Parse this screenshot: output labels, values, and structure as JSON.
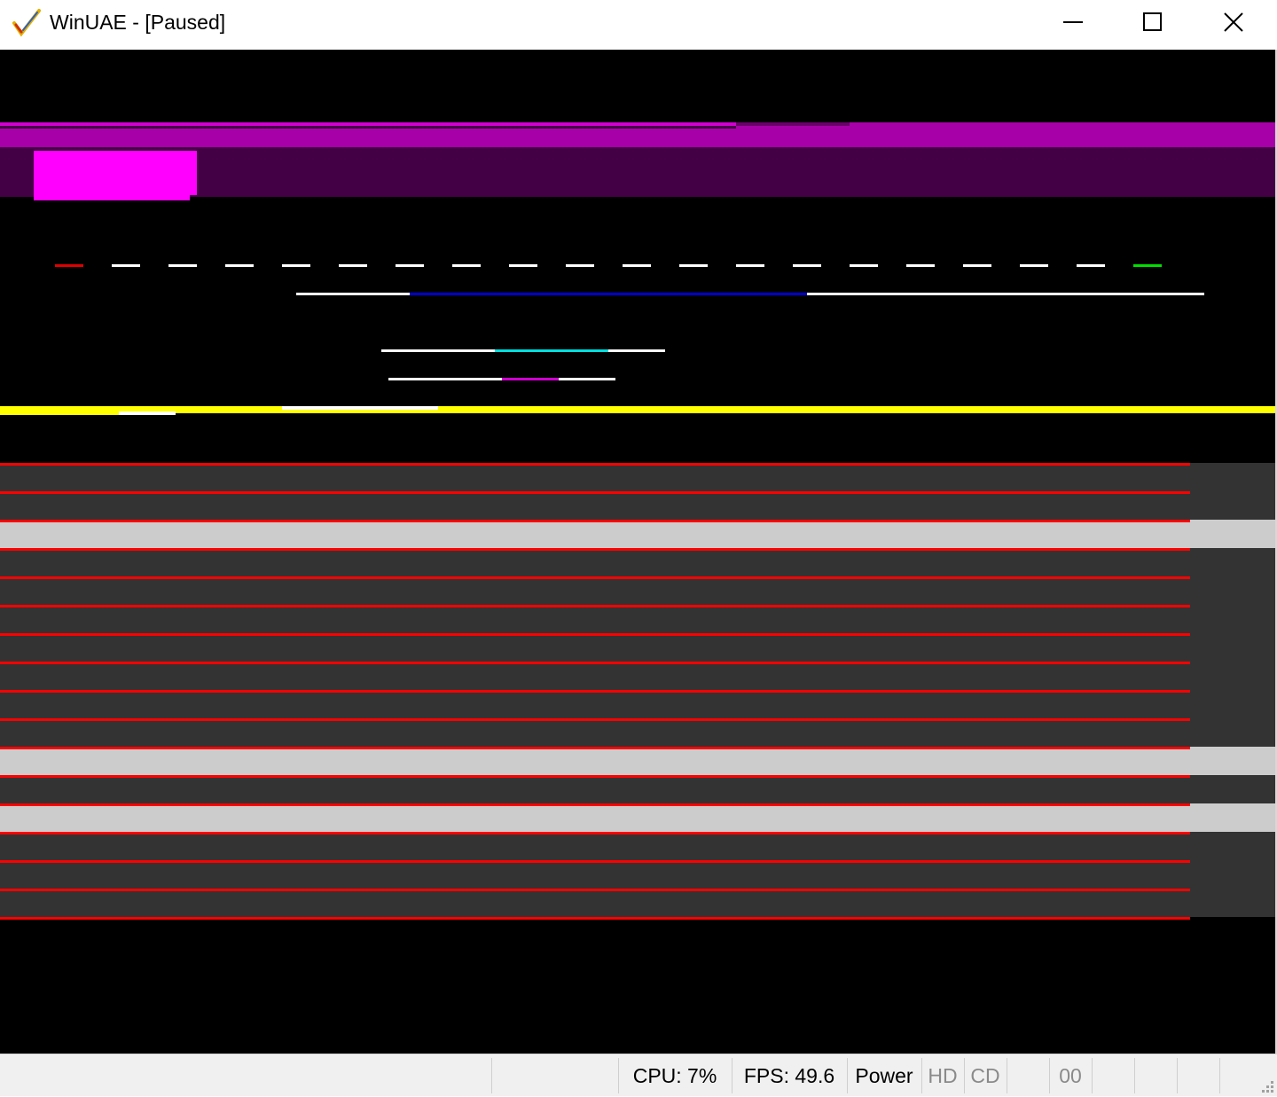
{
  "window": {
    "title": "WinUAE - [Paused]",
    "icon": "winuae-checkmark-icon",
    "controls": [
      "minimize-icon",
      "maximize-icon",
      "close-icon"
    ]
  },
  "statusbar": {
    "cpu": "CPU: 7%",
    "fps": "FPS: 49.6",
    "power": "Power",
    "hd": "HD",
    "cd": "CD",
    "drive": "00"
  },
  "colors": {
    "screen_background": "#000000",
    "magenta_bright": "#ff00ff",
    "magenta_mid": "#a800a8",
    "magenta_dark": "#440044",
    "copper_red": "#ff0000",
    "copper_yellow": "#ffff00",
    "copper_blue": "#0000d0",
    "copper_cyan": "#00e0e0",
    "dark_grey_band": "#333333",
    "light_grey_band": "#cccccc",
    "status_green": "#00ff00"
  }
}
